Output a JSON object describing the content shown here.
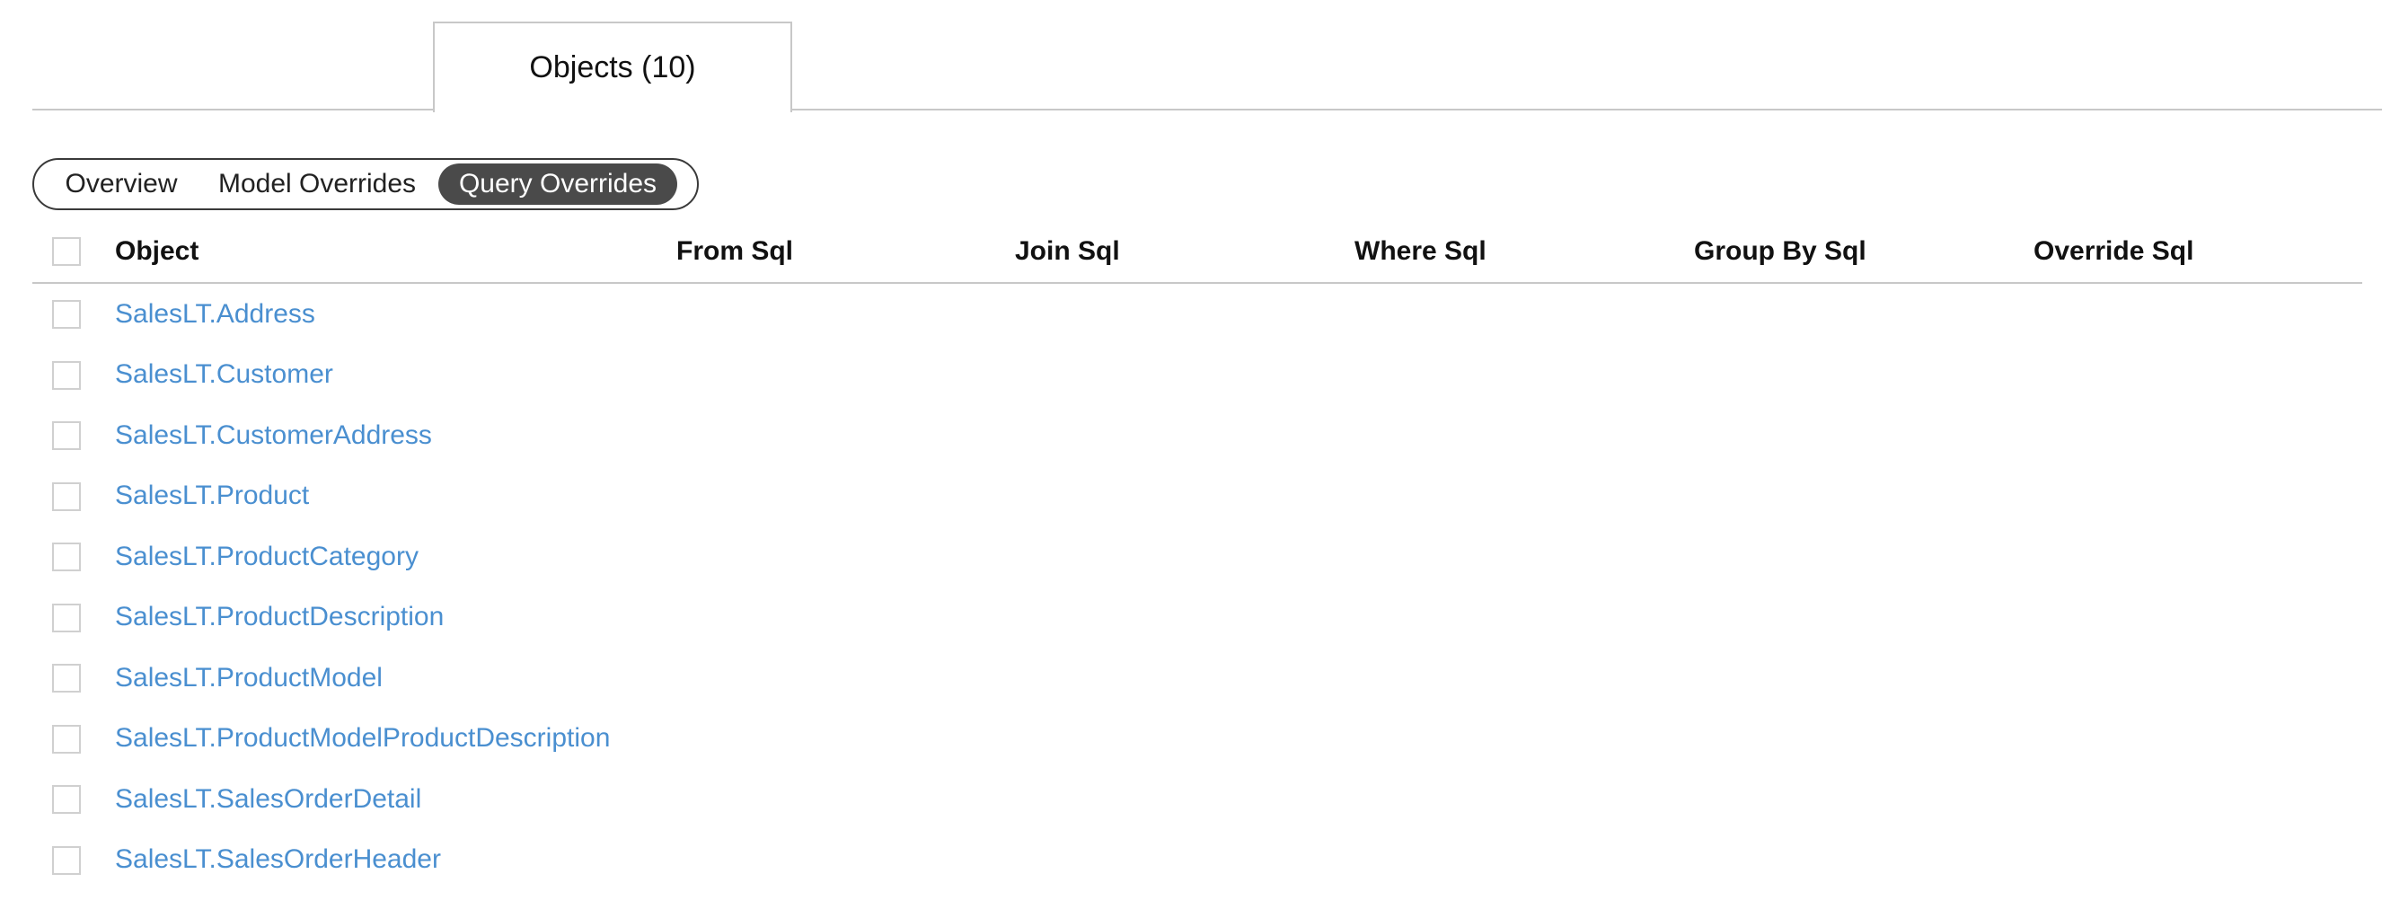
{
  "tabs": [
    {
      "label": "Objects (10)",
      "active": true
    }
  ],
  "view_switch": {
    "options": [
      "Overview",
      "Model Overrides",
      "Query Overrides"
    ],
    "selected": "Query Overrides"
  },
  "table": {
    "columns": [
      "Object",
      "From Sql",
      "Join Sql",
      "Where Sql",
      "Group By Sql",
      "Override Sql"
    ],
    "rows": [
      {
        "object": "SalesLT.Address"
      },
      {
        "object": "SalesLT.Customer"
      },
      {
        "object": "SalesLT.CustomerAddress"
      },
      {
        "object": "SalesLT.Product"
      },
      {
        "object": "SalesLT.ProductCategory"
      },
      {
        "object": "SalesLT.ProductDescription"
      },
      {
        "object": "SalesLT.ProductModel"
      },
      {
        "object": "SalesLT.ProductModelProductDescription"
      },
      {
        "object": "SalesLT.SalesOrderDetail"
      },
      {
        "object": "SalesLT.SalesOrderHeader"
      }
    ]
  },
  "colors": {
    "link": "#4a8fd0",
    "selected_segment_bg": "#4a4a4a",
    "border": "#c8c8c8"
  }
}
